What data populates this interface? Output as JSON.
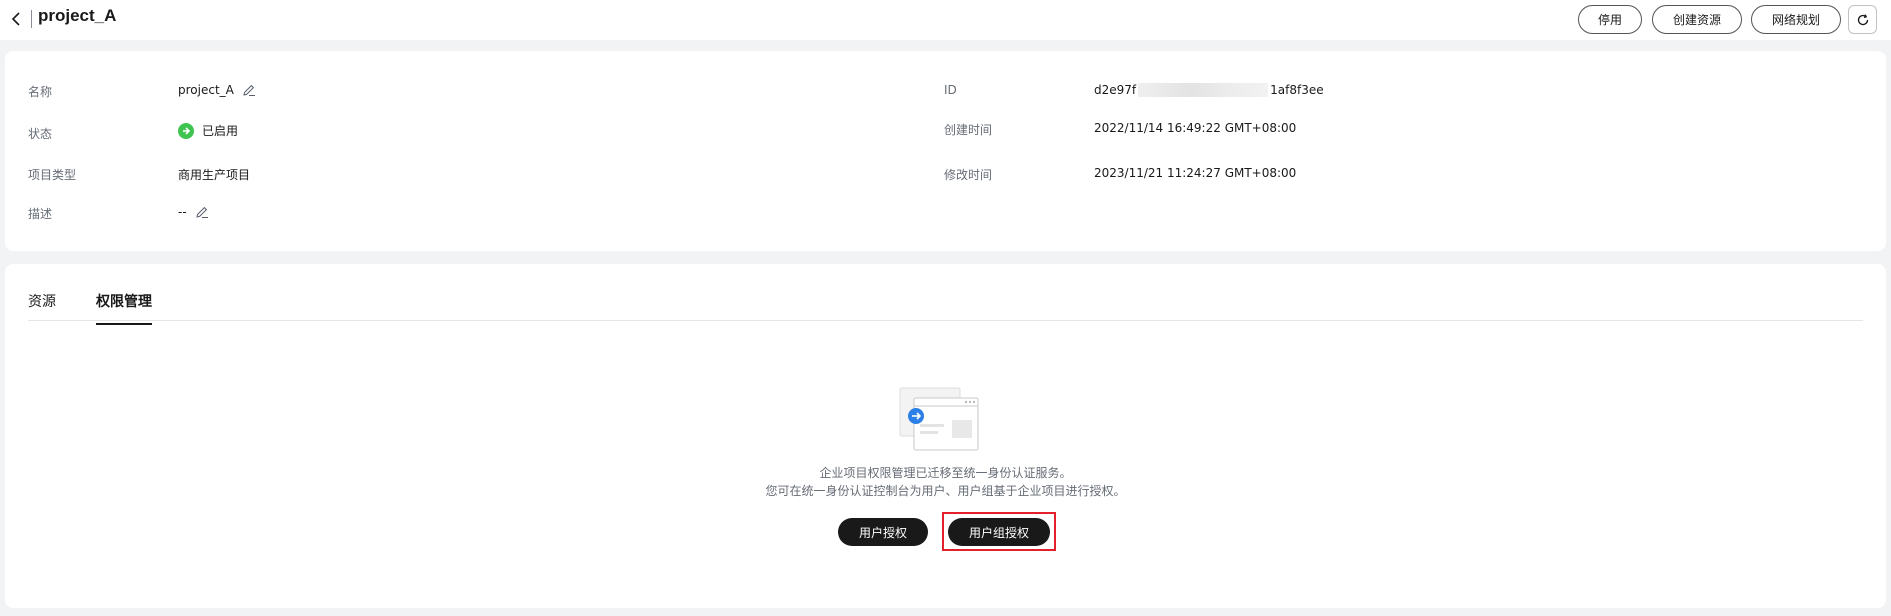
{
  "header": {
    "title": "project_A",
    "buttons": {
      "disable": "停用",
      "create_resource": "创建资源",
      "network_planning": "网络规划"
    }
  },
  "info": {
    "name_label": "名称",
    "name_value": "project_A",
    "status_label": "状态",
    "status_value": "已启用",
    "type_label": "项目类型",
    "type_value": "商用生产项目",
    "desc_label": "描述",
    "desc_value": "--",
    "id_label": "ID",
    "id_prefix": "d2e97f",
    "id_suffix": "1af8f3ee",
    "created_label": "创建时间",
    "created_value": "2022/11/14 16:49:22 GMT+08:00",
    "modified_label": "修改时间",
    "modified_value": "2023/11/21 11:24:27 GMT+08:00"
  },
  "tabs": [
    {
      "label": "资源",
      "active": false
    },
    {
      "label": "权限管理",
      "active": true
    }
  ],
  "empty_state": {
    "line1": "企业项目权限管理已迁移至统一身份认证服务。",
    "line2": "您可在统一身份认证控制台为用户、用户组基于企业项目进行授权。",
    "user_auth_button": "用户授权",
    "group_auth_button": "用户组授权"
  },
  "colors": {
    "status_green": "#3ec44f",
    "primary_dark": "#191919",
    "highlight_red": "#e3202b",
    "illus_accent": "#2d7fe8"
  }
}
